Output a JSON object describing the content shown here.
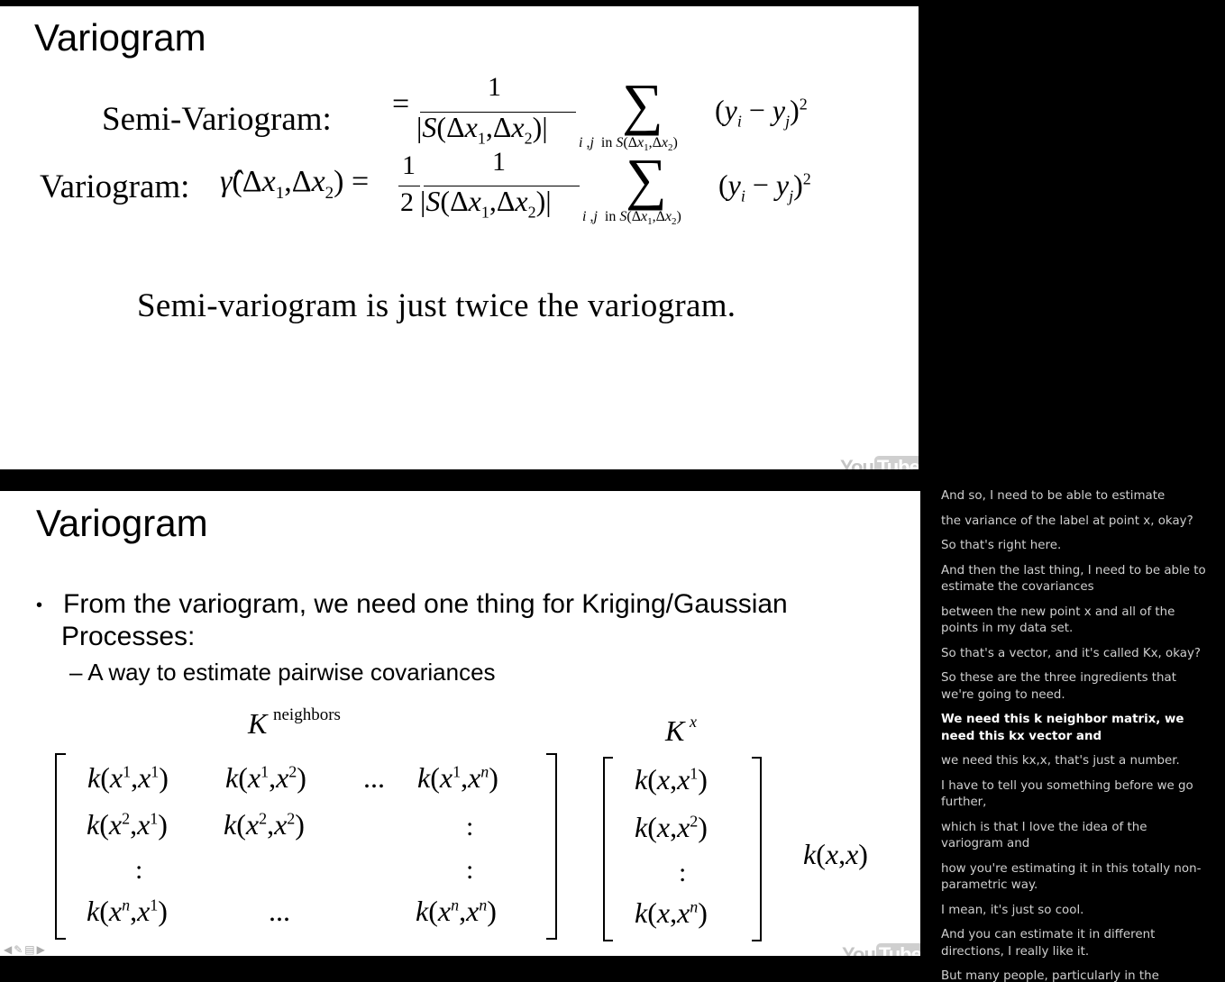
{
  "slide1": {
    "title": "Variogram",
    "semi_label": "Semi-Variogram:",
    "var_label": "Variogram:",
    "note": "Semi-variogram is just twice the variogram.",
    "watermark_you": "You",
    "watermark_tube": "Tube"
  },
  "slide2": {
    "title": "Variogram",
    "bullet": "From the variogram, we need one thing for Kriging/Gaussian",
    "bullet_cont": "Processes:",
    "sub_bullet": "– A way to estimate pairwise covariances",
    "k_neighbors_label": "neighbors",
    "kx_label": "x",
    "watermark_you": "You",
    "watermark_tube": "Tube"
  },
  "transcript": {
    "lines": [
      {
        "text": "And so, I need to be able to estimate",
        "active": false
      },
      {
        "text": "the variance of the label at point x, okay?",
        "active": false
      },
      {
        "text": "So that's right here.",
        "active": false
      },
      {
        "text": "And then the last thing, I need to be able to estimate the covariances",
        "active": false
      },
      {
        "text": "between the new point x and all of the points in my data set.",
        "active": false
      },
      {
        "text": "So that's a vector, and it's called Kx, okay?",
        "active": false
      },
      {
        "text": "So these are the three ingredients that we're going to need.",
        "active": false
      },
      {
        "text": "We need this k neighbor matrix, we need this kx vector and",
        "active": true
      },
      {
        "text": "we need this kx,x, that's just a number.",
        "active": false
      },
      {
        "text": "I have to tell you something before we go further,",
        "active": false
      },
      {
        "text": "which is that I love the idea of the variogram and",
        "active": false
      },
      {
        "text": "how you're estimating it in this totally non-parametric way.",
        "active": false
      },
      {
        "text": "I mean, it's just so cool.",
        "active": false
      },
      {
        "text": "And you can estimate it in different directions, I really like it.",
        "active": false
      },
      {
        "text": "But many people, particularly in the machine",
        "active": false
      }
    ]
  },
  "player_controls": [
    "back-arrow-icon",
    "pen-icon",
    "menu-icon",
    "forward-arrow-icon"
  ],
  "colors": {
    "background": "#000000",
    "slide": "#ffffff",
    "transcript_text": "#cfcfcf",
    "transcript_active": "#ffffff"
  }
}
